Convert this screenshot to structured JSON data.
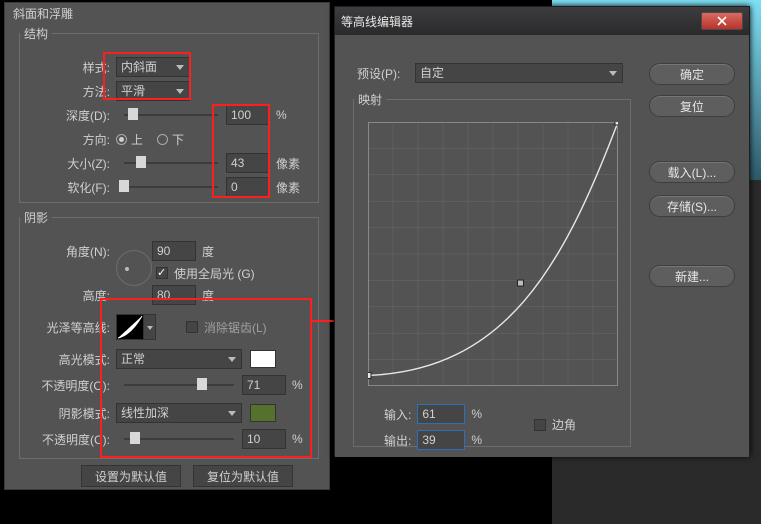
{
  "main": {
    "title": "斜面和浮雕",
    "structure": {
      "legend": "结构",
      "style_label": "样式:",
      "style_value": "内斜面",
      "technique_label": "方法:",
      "technique_value": "平滑",
      "depth_label": "深度(D):",
      "depth_value": "100",
      "depth_unit": "%",
      "direction_label": "方向:",
      "direction_up": "上",
      "direction_down": "下",
      "direction_selected": "up",
      "size_label": "大小(Z):",
      "size_value": "43",
      "size_unit": "像素",
      "soften_label": "软化(F):",
      "soften_value": "0",
      "soften_unit": "像素"
    },
    "shading": {
      "legend": "阴影",
      "angle_label": "角度(N):",
      "angle_value": "90",
      "angle_unit": "度",
      "global_light_label": "使用全局光 (G)",
      "global_light_on": true,
      "altitude_label": "高度:",
      "altitude_value": "80",
      "altitude_unit": "度",
      "gloss_label": "光泽等高线:",
      "antialias_label": "消除锯齿(L)",
      "antialias_on": false,
      "highlight_mode_label": "高光模式:",
      "highlight_mode_value": "正常",
      "highlight_swatch": "#ffffff",
      "highlight_opacity_label": "不透明度(O):",
      "highlight_opacity_value": "71",
      "highlight_opacity_unit": "%",
      "shadow_mode_label": "阴影模式:",
      "shadow_mode_value": "线性加深",
      "shadow_swatch": "#56702d",
      "shadow_opacity_label": "不透明度(C):",
      "shadow_opacity_value": "10",
      "shadow_opacity_unit": "%"
    },
    "buttons": {
      "make_default": "设置为默认值",
      "reset_default": "复位为默认值"
    }
  },
  "dialog": {
    "title": "等高线编辑器",
    "preset_label": "预设(P):",
    "preset_value": "自定",
    "mapping_legend": "映射",
    "input_label": "输入:",
    "input_value": "61",
    "input_unit": "%",
    "output_label": "输出:",
    "output_value": "39",
    "output_unit": "%",
    "corner_label": "边角",
    "corner_on": false,
    "ok": "确定",
    "reset": "复位",
    "load": "载入(L)...",
    "save": "存储(S)...",
    "newp": "新建..."
  },
  "chart_data": {
    "type": "line",
    "title": "映射",
    "xlabel": "输入",
    "ylabel": "输出",
    "xlim": [
      0,
      100
    ],
    "ylim": [
      0,
      100
    ],
    "points": [
      {
        "x": 0,
        "y": 4
      },
      {
        "x": 61,
        "y": 39,
        "selected": true
      },
      {
        "x": 100,
        "y": 100
      }
    ],
    "grid": true
  }
}
